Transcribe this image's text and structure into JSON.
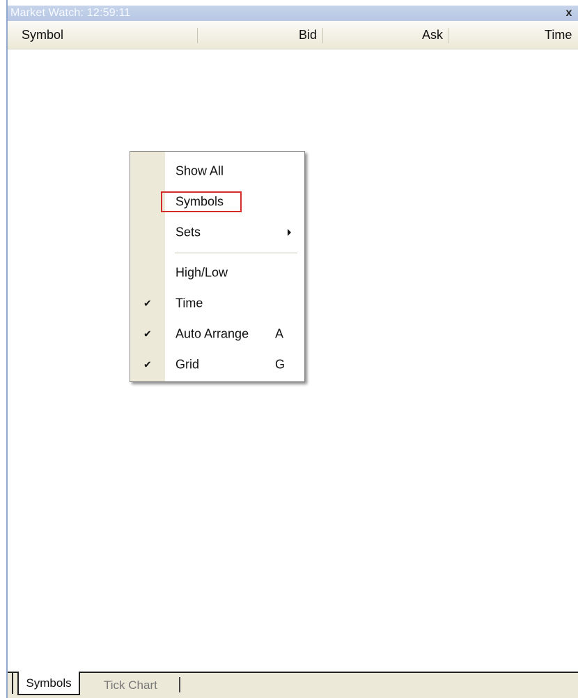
{
  "window": {
    "title": "Market Watch: 12:59:11",
    "close_label": "x"
  },
  "table": {
    "columns": [
      "Symbol",
      "Bid",
      "Ask",
      "Time"
    ]
  },
  "context_menu": {
    "items": [
      {
        "label": "Show All",
        "checked": false,
        "shortcut": "",
        "submenu": false
      },
      {
        "label": "Symbols",
        "checked": false,
        "shortcut": "",
        "submenu": false,
        "highlighted": true
      },
      {
        "label": "Sets",
        "checked": false,
        "shortcut": "",
        "submenu": true
      },
      {
        "label": "High/Low",
        "checked": false,
        "shortcut": "",
        "submenu": false
      },
      {
        "label": "Time",
        "checked": true,
        "shortcut": "",
        "submenu": false
      },
      {
        "label": "Auto Arrange",
        "checked": true,
        "shortcut": "A",
        "submenu": false
      },
      {
        "label": "Grid",
        "checked": true,
        "shortcut": "G",
        "submenu": false
      }
    ],
    "check_glyph": "✔",
    "highlight_color": "#d52b2b"
  },
  "tabs": {
    "items": [
      {
        "label": "Symbols",
        "active": true
      },
      {
        "label": "Tick Chart",
        "active": false
      }
    ]
  }
}
